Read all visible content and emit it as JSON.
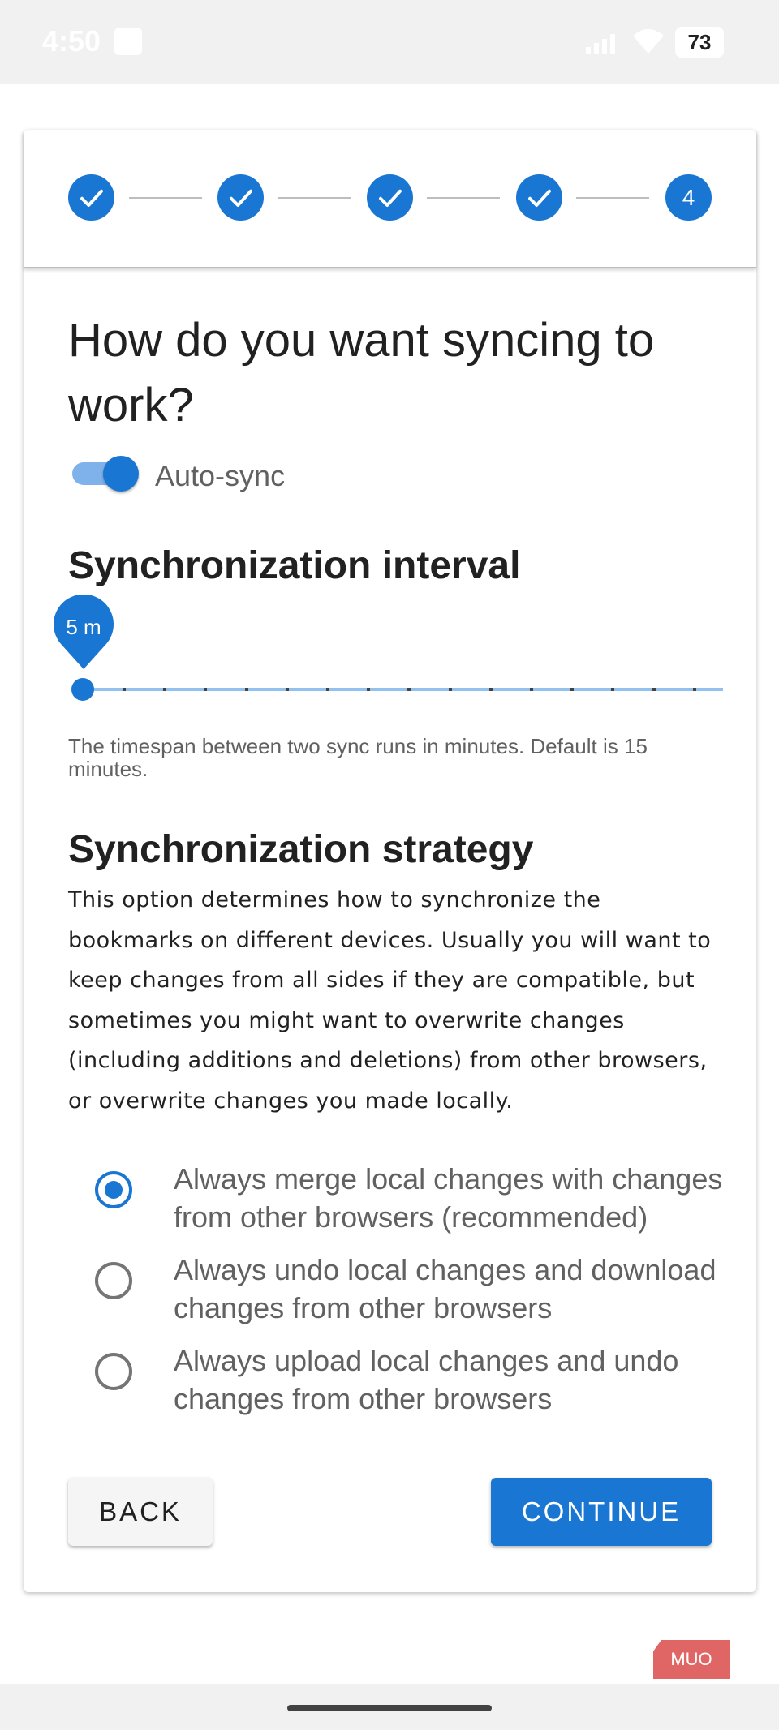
{
  "status_bar": {
    "time": "4:50",
    "battery": "73",
    "icons": [
      "app-notification-icon",
      "signal-icon",
      "wifi-icon",
      "battery-icon"
    ]
  },
  "stepper": {
    "steps": [
      {
        "state": "complete",
        "icon": "check-icon"
      },
      {
        "state": "complete",
        "icon": "check-icon"
      },
      {
        "state": "complete",
        "icon": "check-icon"
      },
      {
        "state": "complete",
        "icon": "check-icon"
      },
      {
        "state": "active",
        "number": "4"
      }
    ]
  },
  "main": {
    "title": "How do you want syncing to work?",
    "auto_sync": {
      "label": "Auto-sync",
      "enabled": true
    },
    "interval": {
      "heading": "Synchronization interval",
      "value_label": "5 m",
      "slider_fraction": 0,
      "helper": "The timespan between two sync runs in minutes. Default is 15 minutes."
    },
    "strategy": {
      "heading": "Synchronization strategy",
      "description": "This option determines how to synchronize the bookmarks on different devices. Usually you will want to keep changes from all sides if they are compatible, but sometimes you might want to overwrite changes (including additions and deletions) from other browsers, or overwrite changes you made locally.",
      "options": [
        {
          "label": "Always merge local changes with changes from other browsers (recommended)",
          "selected": true
        },
        {
          "label": "Always undo local changes and download changes from other browsers",
          "selected": false
        },
        {
          "label": "Always upload local changes and undo changes from other browsers",
          "selected": false
        }
      ]
    },
    "buttons": {
      "back": "BACK",
      "continue": "CONTINUE"
    }
  },
  "watermark": "MUO",
  "colors": {
    "accent": "#1976d2",
    "accent_light": "#90c1ef",
    "watermark": "#e06666"
  }
}
